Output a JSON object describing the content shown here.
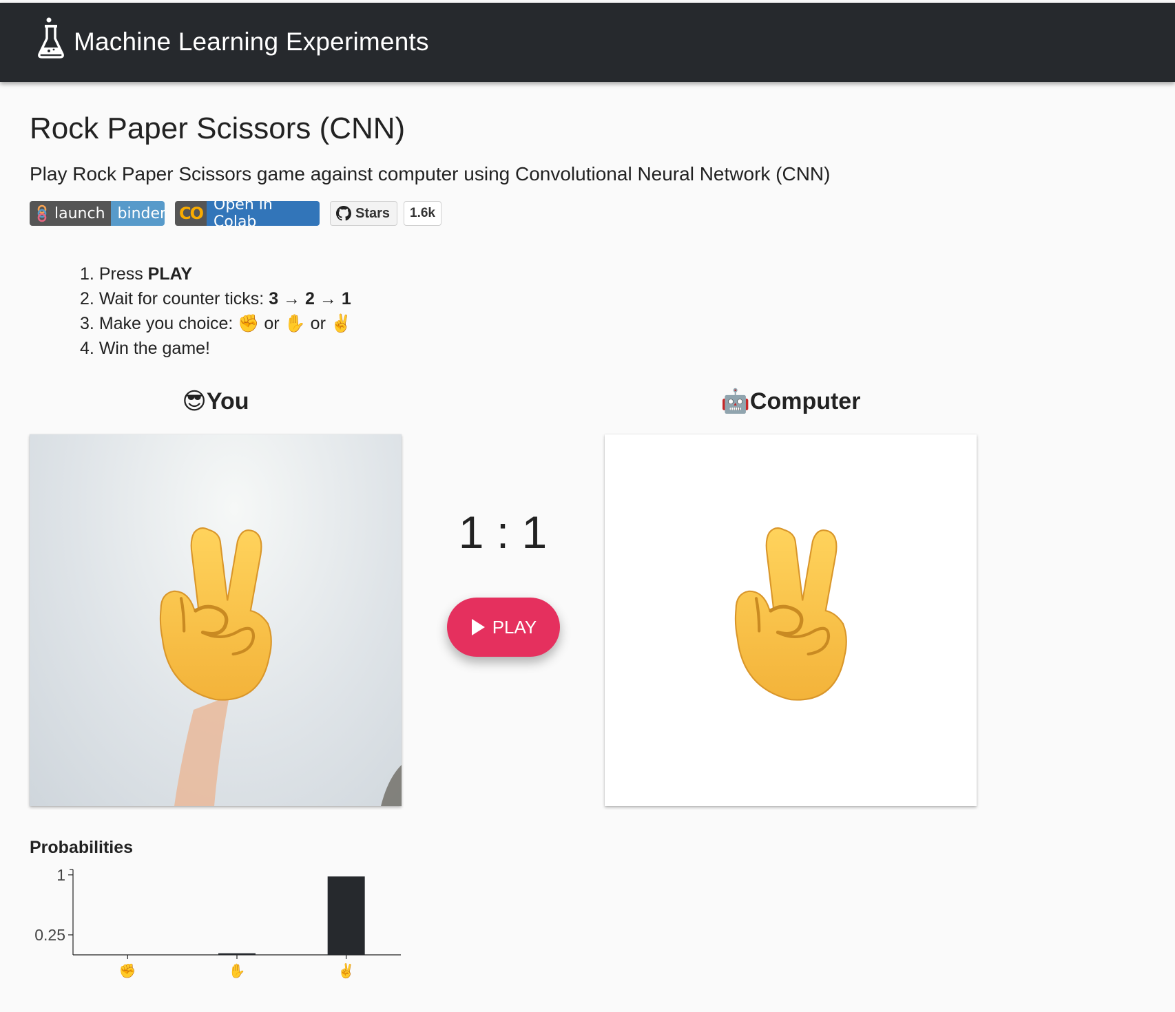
{
  "header": {
    "title": "Machine Learning Experiments",
    "logo_icon": "flask-icon"
  },
  "page": {
    "title": "Rock Paper Scissors (CNN)",
    "subtitle": "Play Rock Paper Scissors game against computer using Convolutional Neural Network (CNN)"
  },
  "badges": {
    "binder": {
      "left": "launch",
      "right": "binder",
      "icon": "binder-icon"
    },
    "colab": {
      "left": "CO",
      "right": "Open in Colab",
      "icon": "colab-icon"
    },
    "github": {
      "label": "Stars",
      "count": "1.6k",
      "icon": "github-icon"
    }
  },
  "instructions": {
    "step1": {
      "number": "1.",
      "text": "Press ",
      "bold": "PLAY"
    },
    "step2": {
      "number": "2.",
      "text": "Wait for counter ticks: ",
      "n3": "3",
      "arrow": " → ",
      "n2": "2",
      "n1": "1"
    },
    "step3": {
      "number": "3.",
      "text": "Make you choice: ",
      "rock": "✊",
      "or": " or ",
      "paper": "✋",
      "scissors": "✌️"
    },
    "step4": {
      "number": "4.",
      "text": "Win the game!"
    }
  },
  "players": {
    "user": {
      "emoji": "😎",
      "label": "You",
      "choice": "scissors"
    },
    "computer": {
      "emoji": "🤖",
      "label": "Computer",
      "choice": "scissors"
    }
  },
  "score": {
    "user": "1",
    "separator": ":",
    "computer": "1"
  },
  "play_button": {
    "label": "PLAY",
    "icon": "play-icon"
  },
  "probabilities": {
    "title": "Probabilities",
    "chart_data": {
      "type": "bar",
      "categories": [
        "✊",
        "✋",
        "✌️"
      ],
      "values": [
        0.0,
        0.02,
        0.98
      ],
      "y_ticks": [
        "1",
        "0.25"
      ],
      "y_tick_values": [
        1,
        0.25
      ],
      "ylim": [
        0,
        1.05
      ],
      "bar_color": "#26292d"
    }
  },
  "colors": {
    "header_bg": "#26292d",
    "accent": "#e5305e",
    "binder_blue": "#579aca",
    "colab_blue": "#3275b9",
    "badge_gray": "#555555"
  }
}
